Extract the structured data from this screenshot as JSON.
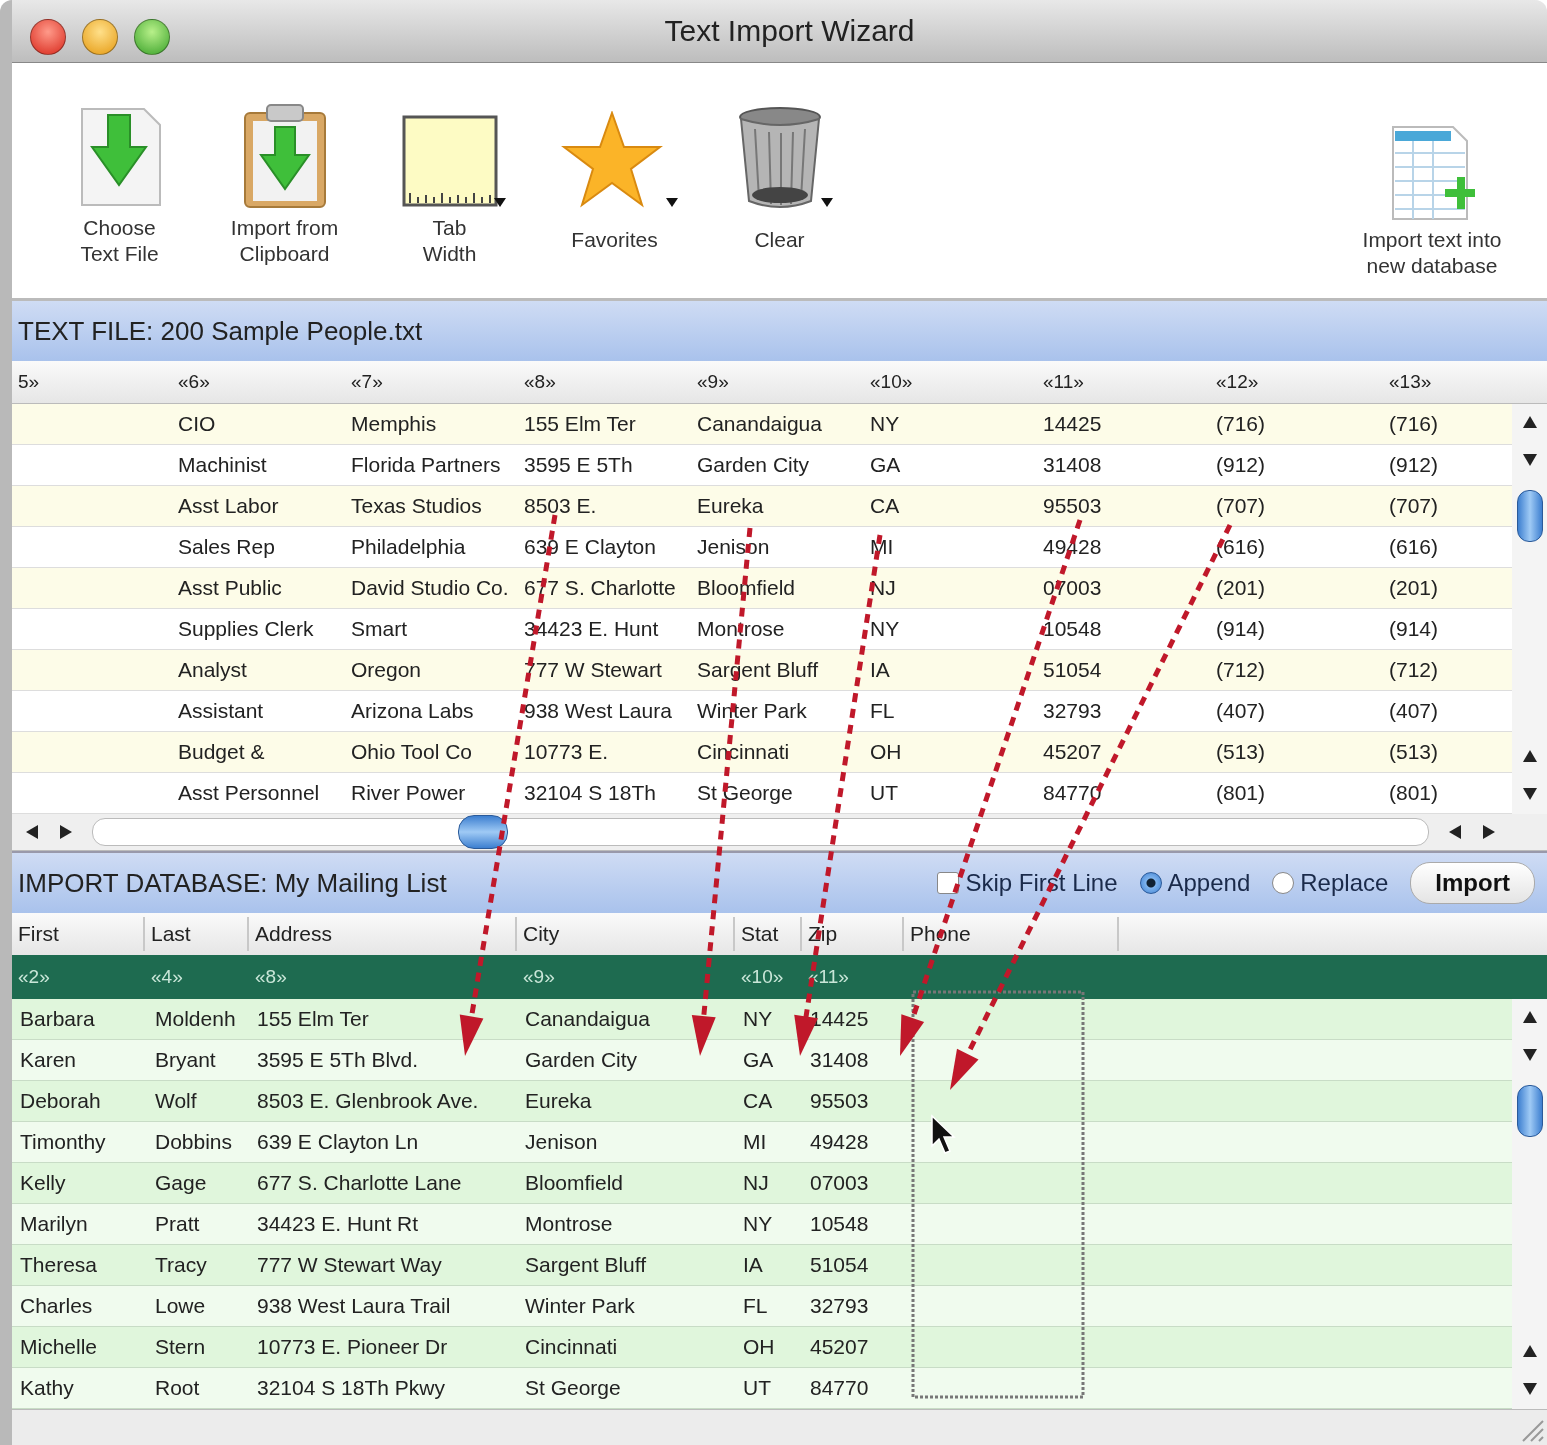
{
  "window": {
    "title": "Text Import Wizard"
  },
  "toolbar": [
    {
      "label": "Choose\nText File",
      "kind": "download-doc",
      "has_menu": false
    },
    {
      "label": "Import from\nClipboard",
      "kind": "clipboard",
      "has_menu": false
    },
    {
      "label": "Tab\nWidth",
      "kind": "ruler",
      "has_menu": true
    },
    {
      "label": "Favorites",
      "kind": "star",
      "has_menu": true
    },
    {
      "label": "Clear",
      "kind": "trash",
      "has_menu": true
    },
    {
      "label": "Import text into\nnew database",
      "kind": "spreadsheet",
      "has_menu": false
    }
  ],
  "source": {
    "title": "TEXT FILE: 200 Sample People.txt",
    "columns": [
      "5»",
      "«6»",
      "«7»",
      "«8»",
      "«9»",
      "«10»",
      "«11»",
      "«12»",
      "«13»"
    ],
    "rows": [
      [
        "",
        "CIO",
        "Memphis",
        "155 Elm Ter",
        "Canandaigua",
        "NY",
        "14425",
        "(716)",
        "(716)"
      ],
      [
        "",
        "Machinist",
        "Florida Partners",
        "3595 E 5Th",
        "Garden City",
        "GA",
        "31408",
        "(912)",
        "(912)"
      ],
      [
        "",
        "Asst Labor",
        "Texas Studios",
        "8503 E.",
        "Eureka",
        "CA",
        "95503",
        "(707)",
        "(707)"
      ],
      [
        "",
        "Sales Rep",
        "Philadelphia",
        "639 E Clayton",
        "Jenison",
        "MI",
        "49428",
        "(616)",
        "(616)"
      ],
      [
        "",
        "Asst Public",
        "David Studio Co.",
        "677 S. Charlotte",
        "Bloomfield",
        "NJ",
        "07003",
        "(201)",
        "(201)"
      ],
      [
        "",
        "Supplies Clerk",
        "Smart",
        "34423 E. Hunt",
        "Montrose",
        "NY",
        "10548",
        "(914)",
        "(914)"
      ],
      [
        "",
        "Analyst",
        "Oregon",
        "777 W Stewart",
        "Sargent Bluff",
        "IA",
        "51054",
        "(712)",
        "(712)"
      ],
      [
        "",
        "Assistant",
        "Arizona Labs",
        "938 West Laura",
        "Winter Park",
        "FL",
        "32793",
        "(407)",
        "(407)"
      ],
      [
        "",
        "Budget &",
        "Ohio Tool Co",
        "10773 E.",
        "Cincinnati",
        "OH",
        "45207",
        "(513)",
        "(513)"
      ],
      [
        "",
        "Asst Personnel",
        "River Power",
        "32104 S 18Th",
        "St George",
        "UT",
        "84770",
        "(801)",
        "(801)"
      ]
    ]
  },
  "target": {
    "title": "IMPORT DATABASE: My Mailing List",
    "skip_first_line": {
      "label": "Skip First Line",
      "checked": false
    },
    "mode": [
      {
        "label": "Append",
        "selected": true
      },
      {
        "label": "Replace",
        "selected": false
      }
    ],
    "import_button": "Import",
    "columns": [
      {
        "name": "First",
        "mapping": "«2»"
      },
      {
        "name": "Last",
        "mapping": "«4»"
      },
      {
        "name": "Address",
        "mapping": "«8»"
      },
      {
        "name": "City",
        "mapping": "«9»"
      },
      {
        "name": "Stat",
        "mapping": "«10»"
      },
      {
        "name": "Zip",
        "mapping": "«11»"
      },
      {
        "name": "Phone"
      }
    ],
    "rows": [
      [
        "Barbara",
        "Moldenh",
        "155 Elm Ter",
        "Canandaigua",
        "NY",
        "14425"
      ],
      [
        "Karen",
        "Bryant",
        "3595 E 5Th Blvd.",
        "Garden City",
        "GA",
        "31408"
      ],
      [
        "Deborah",
        "Wolf",
        "8503 E. Glenbrook Ave.",
        "Eureka",
        "CA",
        "95503"
      ],
      [
        "Timonthy",
        "Dobbins",
        "639 E Clayton Ln",
        "Jenison",
        "MI",
        "49428"
      ],
      [
        "Kelly",
        "Gage",
        "677 S. Charlotte Lane",
        "Bloomfield",
        "NJ",
        "07003"
      ],
      [
        "Marilyn",
        "Pratt",
        "34423 E. Hunt Rt",
        "Montrose",
        "NY",
        "10548"
      ],
      [
        "Theresa",
        "Tracy",
        "777 W Stewart Way",
        "Sargent Bluff",
        "IA",
        "51054"
      ],
      [
        "Charles",
        "Lowe",
        "938 West Laura Trail",
        "Winter Park",
        "FL",
        "32793"
      ],
      [
        "Michelle",
        "Stern",
        "10773 E. Pioneer Dr",
        "Cincinnati",
        "OH",
        "45207"
      ],
      [
        "Kathy",
        "Root",
        "32104 S 18Th Pkwy",
        "St George",
        "UT",
        "84770"
      ]
    ]
  }
}
